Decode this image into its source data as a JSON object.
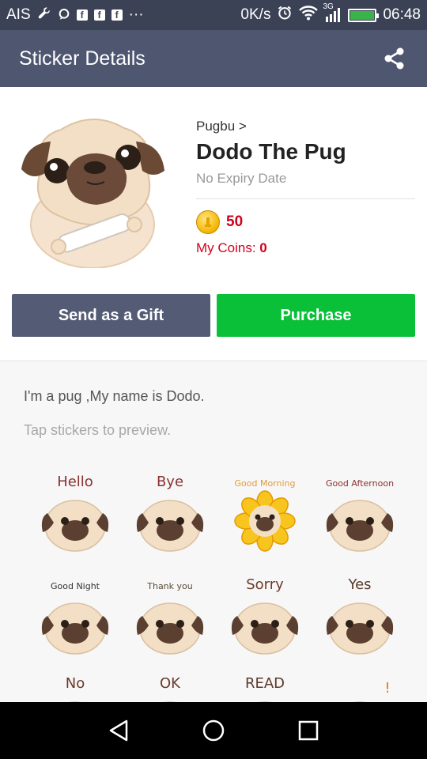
{
  "status_bar": {
    "carrier": "AIS",
    "net_speed": "0K/s",
    "net_type": "3G",
    "time": "06:48",
    "fb_glyph": "f",
    "more_glyph": "···"
  },
  "header": {
    "title": "Sticker Details",
    "share_icon": "share-icon"
  },
  "sticker": {
    "author": "Pugbu >",
    "title": "Dodo The Pug",
    "expiry": "No Expiry Date",
    "price": "50",
    "my_coins_label": "My Coins: ",
    "my_coins_value": "0"
  },
  "buttons": {
    "gift_label": "Send as a Gift",
    "purchase_label": "Purchase"
  },
  "description": "I'm a pug ,My name is Dodo.",
  "hint": "Tap stickers to preview.",
  "sticker_captions": [
    "Hello",
    "Bye",
    "Good Morning",
    "Good Afternoon",
    "Good Night",
    "Thank you",
    "Sorry",
    "Yes",
    "No",
    "OK",
    "READ",
    "!"
  ],
  "colors": {
    "status_bar": "#3b4256",
    "app_bar": "#4e5670",
    "gift_button": "#535b75",
    "purchase_button": "#09c038",
    "price_red": "#d0021b"
  }
}
